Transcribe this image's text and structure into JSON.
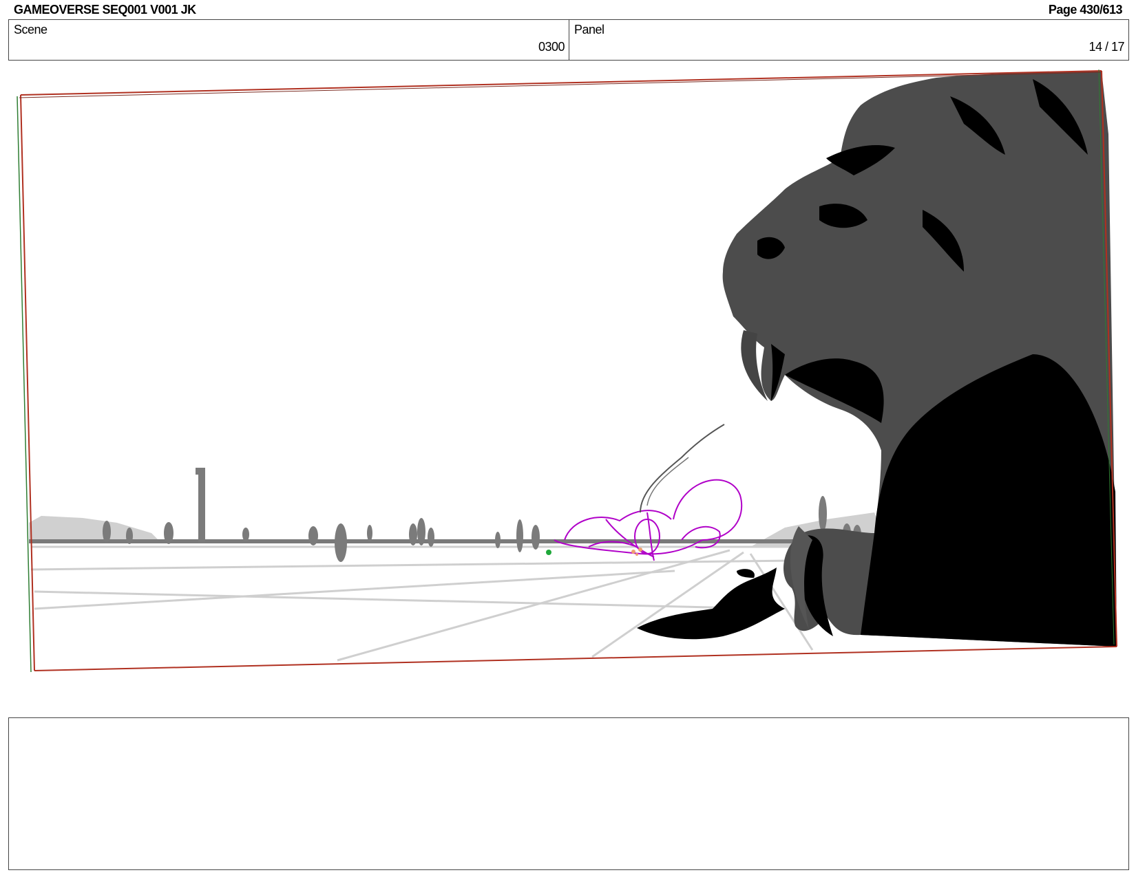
{
  "header": {
    "doc_title": "GAMEOVERSE SEQ001 V001 JK",
    "page_label": "Page 430/613"
  },
  "info": {
    "scene_label": "Scene",
    "scene_value": "0300",
    "panel_label": "Panel",
    "panel_value": "14 / 17"
  },
  "panel_image": {
    "description_icon": "storyboard-sketch",
    "colors": {
      "frame_red": "#c0392b",
      "frame_green": "#2e7d32",
      "creature": "#4a4a4a",
      "shadow": "#000000",
      "horizon": "#777777",
      "ground_lines": "#cccccc",
      "character_sketch": "#b000c8"
    }
  },
  "notes": {
    "text": ""
  }
}
